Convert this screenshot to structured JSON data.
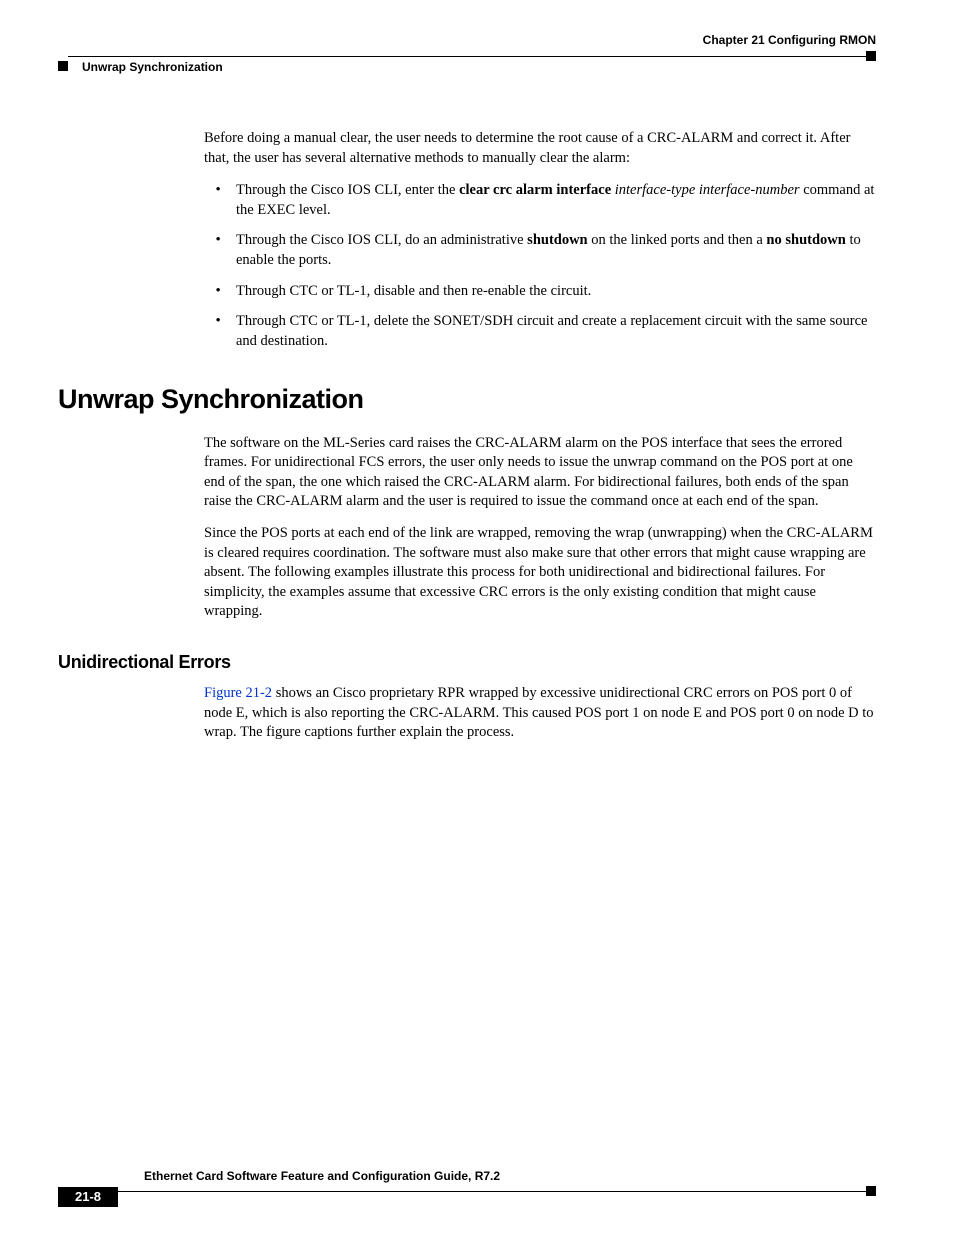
{
  "header": {
    "chapter": "Chapter 21    Configuring RMON",
    "section": "Unwrap Synchronization"
  },
  "body": {
    "intro_para": "Before doing a manual clear, the user needs to determine the root cause of a CRC-ALARM and correct it. After that, the user has several alternative methods to manually clear the alarm:",
    "bullets": {
      "b1_pre": "Through the Cisco IOS CLI, enter the ",
      "b1_cmd": "clear crc alarm interface",
      "b1_args": " interface-type interface-number",
      "b1_post": " command at the EXEC level.",
      "b2_pre": "Through the Cisco IOS CLI, do an administrative ",
      "b2_k1": "shutdown",
      "b2_mid": " on the linked ports and then a ",
      "b2_k2": "no shutdown",
      "b2_post": " to enable the ports.",
      "b3": "Through CTC or TL-1, disable and then re-enable the circuit.",
      "b4": "Through CTC or TL-1, delete the SONET/SDH circuit and create a replacement circuit with the same source and destination."
    },
    "h1": "Unwrap Synchronization",
    "p1": "The software on the ML-Series card raises the CRC-ALARM alarm on the POS interface that sees the errored frames. For unidirectional FCS errors, the user only needs to issue the unwrap command on the POS port at one end of the span, the one which raised the CRC-ALARM alarm. For bidirectional failures, both ends of the span raise the CRC-ALARM alarm and the user is required to issue the command once at each end of the span.",
    "p2": "Since the POS ports at each end of the link are wrapped, removing the wrap (unwrapping) when the CRC-ALARM is cleared requires coordination. The software must also make sure that other errors that might cause wrapping are absent. The following examples illustrate this process for both unidirectional and bidirectional failures. For simplicity, the examples assume that excessive CRC errors is the only existing condition that might cause wrapping.",
    "h2": "Unidirectional Errors",
    "link_text": "Figure 21-2",
    "p3_post": " shows an Cisco proprietary RPR  wrapped by excessive unidirectional CRC errors on POS port 0 of node E, which is also reporting the CRC-ALARM. This caused POS port 1 on node E and POS port 0 on node D to wrap. The figure captions further explain the process."
  },
  "footer": {
    "title": "Ethernet Card Software Feature and Configuration Guide, R7.2",
    "page": "21-8"
  }
}
